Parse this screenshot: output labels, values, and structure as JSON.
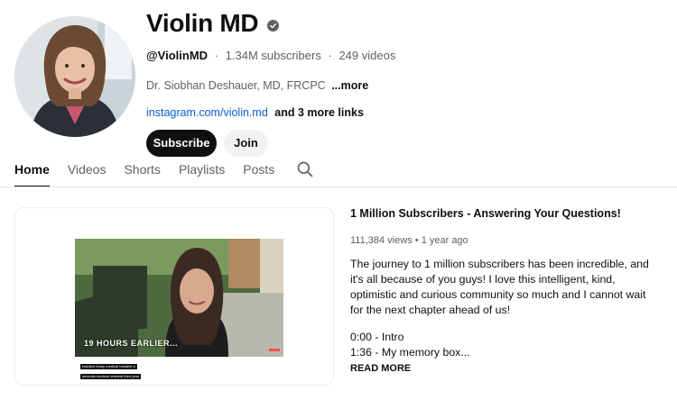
{
  "channel": {
    "name": "Violin MD",
    "handle": "@ViolinMD",
    "subscribers": "1.34M subscribers",
    "videos": "249 videos",
    "description": "Dr. Siobhan Deshauer, MD, FRCPC",
    "description_more": "...more",
    "link_primary": "instagram.com/violin.md",
    "link_more": "and 3 more links",
    "subscribe_label": "Subscribe",
    "join_label": "Join"
  },
  "tabs": [
    {
      "label": "Home",
      "active": true
    },
    {
      "label": "Videos"
    },
    {
      "label": "Shorts"
    },
    {
      "label": "Playlists"
    },
    {
      "label": "Posts"
    }
  ],
  "featured": {
    "title": "1 Million Subscribers - Answering Your Questions!",
    "views": "111,384 views",
    "age": "1 year ago",
    "description": "The journey to 1 million subscribers has been incredible, and it's all because of you guys! I love this intelligent, kind, optimistic and curious community so much and I cannot wait for the next chapter ahead of us!",
    "chapters": [
      "0:00 - Intro",
      "1:36 - My memory box..."
    ],
    "read_more": "READ MORE",
    "overlay_text": "19 HOURS EARLIER...",
    "caption_lines": [
      "resident frosty medical resident a",
      "seconds medical resident third-year"
    ]
  },
  "colors": {
    "link": "#065fd4",
    "subscribe_bg": "#0f0f0f",
    "join_bg": "#f2f2f2",
    "muted": "#606060"
  },
  "icons": {
    "verified": "verified-check-icon",
    "search": "search-icon"
  }
}
